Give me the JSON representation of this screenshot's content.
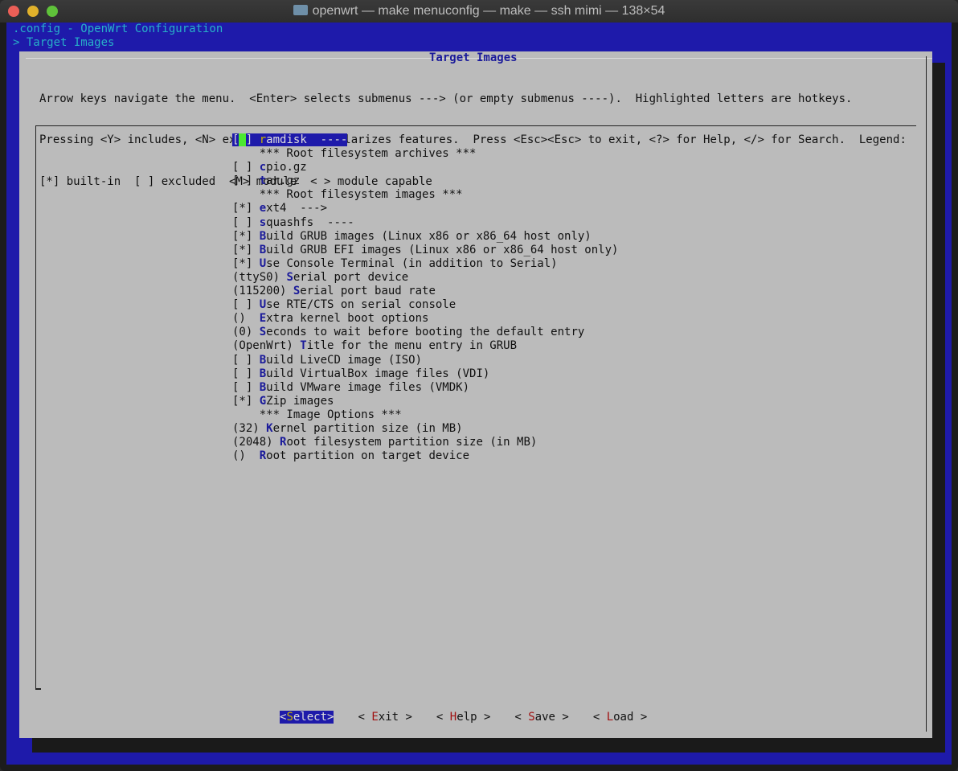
{
  "window": {
    "title": "openwrt — make menuconfig — make — ssh mimi — 138×54"
  },
  "header": {
    "config": ".config - OpenWrt Configuration",
    "breadcrumb": "> Target Images"
  },
  "dialog": {
    "title": "Target Images",
    "help": [
      "Arrow keys navigate the menu.  <Enter> selects submenus ---> (or empty submenus ----).  Highlighted letters are hotkeys.",
      "Pressing <Y> includes, <N> excludes, <M> modularizes features.  Press <Esc><Esc> to exit, <?> for Help, </> for Search.  Legend:",
      "[*] built-in  [ ] excluded  <M> module  < > module capable"
    ],
    "items": [
      {
        "prefix": "[ ] ",
        "key": "r",
        "rest": "amdisk  ----",
        "selected": true
      },
      {
        "prefix": "    ",
        "key": "",
        "rest": "*** Root filesystem archives ***"
      },
      {
        "prefix": "[ ] ",
        "key": "c",
        "rest": "pio.gz"
      },
      {
        "prefix": "[ ] ",
        "key": "t",
        "rest": "ar.gz"
      },
      {
        "prefix": "    ",
        "key": "",
        "rest": "*** Root filesystem images ***"
      },
      {
        "prefix": "[*] ",
        "key": "e",
        "rest": "xt4  --->"
      },
      {
        "prefix": "[ ] ",
        "key": "s",
        "rest": "quashfs  ----"
      },
      {
        "prefix": "[*] ",
        "key": "B",
        "rest": "uild GRUB images (Linux x86 or x86_64 host only)"
      },
      {
        "prefix": "[*] ",
        "key": "B",
        "rest": "uild GRUB EFI images (Linux x86 or x86_64 host only)"
      },
      {
        "prefix": "[*] ",
        "key": "U",
        "rest": "se Console Terminal (in addition to Serial)"
      },
      {
        "prefix": "(ttyS0) ",
        "key": "S",
        "rest": "erial port device"
      },
      {
        "prefix": "(115200) ",
        "key": "S",
        "rest": "erial port baud rate"
      },
      {
        "prefix": "[ ] ",
        "key": "U",
        "rest": "se RTE/CTS on serial console"
      },
      {
        "prefix": "()  ",
        "key": "E",
        "rest": "xtra kernel boot options"
      },
      {
        "prefix": "(0) ",
        "key": "S",
        "rest": "econds to wait before booting the default entry"
      },
      {
        "prefix": "(OpenWrt) ",
        "key": "T",
        "rest": "itle for the menu entry in GRUB"
      },
      {
        "prefix": "[ ] ",
        "key": "B",
        "rest": "uild LiveCD image (ISO)"
      },
      {
        "prefix": "[ ] ",
        "key": "B",
        "rest": "uild VirtualBox image files (VDI)"
      },
      {
        "prefix": "[ ] ",
        "key": "B",
        "rest": "uild VMware image files (VMDK)"
      },
      {
        "prefix": "[*] ",
        "key": "G",
        "rest": "Zip images"
      },
      {
        "prefix": "    ",
        "key": "",
        "rest": "*** Image Options ***"
      },
      {
        "prefix": "(32) ",
        "key": "K",
        "rest": "ernel partition size (in MB)"
      },
      {
        "prefix": "(2048) ",
        "key": "R",
        "rest": "oot filesystem partition size (in MB)"
      },
      {
        "prefix": "()  ",
        "key": "R",
        "rest": "oot partition on target device"
      }
    ],
    "buttons": [
      {
        "open": "<",
        "key": "S",
        "rest": "elect",
        "close": ">",
        "active": true
      },
      {
        "open": "< ",
        "key": "E",
        "rest": "xit",
        "close": " >"
      },
      {
        "open": "< ",
        "key": "H",
        "rest": "elp",
        "close": " >"
      },
      {
        "open": "< ",
        "key": "S",
        "rest": "ave",
        "close": " >"
      },
      {
        "open": "< ",
        "key": "L",
        "rest": "oad",
        "close": " >"
      }
    ]
  },
  "colors": {
    "terminal_bg": "#1e1aaa",
    "dialog_bg": "#bbbbbb",
    "hotkey": "#1a1a9a",
    "button_hotkey": "#a01010",
    "cursor": "#4ce830"
  }
}
